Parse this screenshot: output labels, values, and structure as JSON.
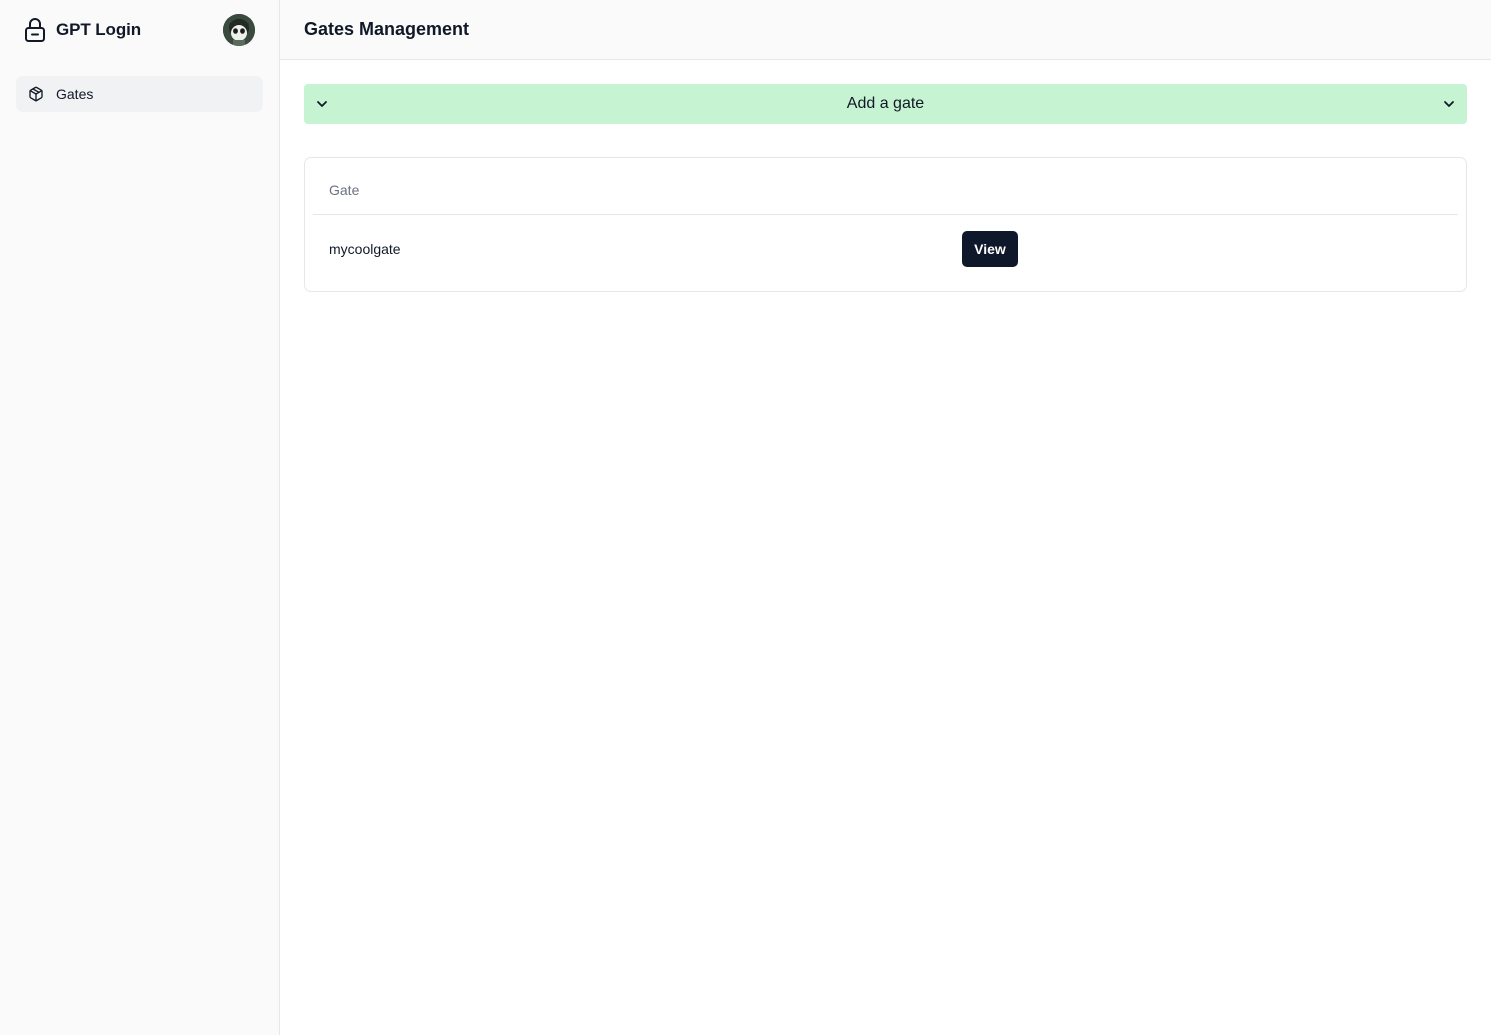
{
  "sidebar": {
    "brand": {
      "title": "GPT Login",
      "icon": "lock-icon"
    },
    "avatar": {
      "icon": "user-avatar"
    },
    "items": [
      {
        "label": "Gates",
        "icon": "cube-icon",
        "active": true
      }
    ]
  },
  "header": {
    "title": "Gates Management"
  },
  "add_gate": {
    "label": "Add a gate",
    "icon": "chevron-down-icon",
    "color": "#c6f4d2"
  },
  "gates_table": {
    "columns": [
      "Gate"
    ],
    "rows": [
      {
        "name": "mycoolgate",
        "action_label": "View"
      }
    ]
  },
  "colors": {
    "sidebar_bg": "#fafafa",
    "active_item_bg": "#f1f2f4",
    "primary_button": "#0f172a",
    "add_gate_bg": "#c6f4d2"
  }
}
